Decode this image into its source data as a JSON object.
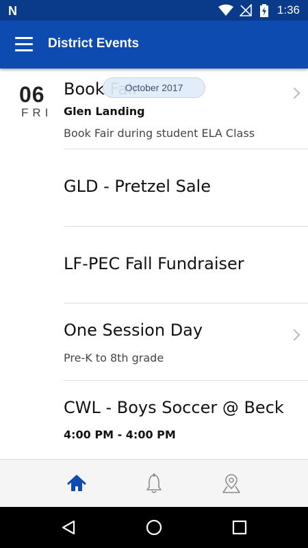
{
  "status_bar": {
    "time": "1:36"
  },
  "app_bar": {
    "title": "District Events"
  },
  "month_pill": "October 2017",
  "date_header": {
    "day_number": "06",
    "day_name": "FRI"
  },
  "events": [
    {
      "title": "Book Fair",
      "location": "Glen Landing",
      "description": "Book Fair during student ELA Class",
      "has_chevron": true
    },
    {
      "title": "GLD - Pretzel Sale"
    },
    {
      "title": "LF-PEC Fall Fundraiser"
    },
    {
      "title": "One Session Day",
      "description": "Pre-K to 8th grade",
      "has_chevron": true
    },
    {
      "title": "CWL - Boys Soccer @ Beck",
      "time": "4:00 PM - 4:00 PM"
    }
  ],
  "bottom_nav": [
    {
      "icon": "home-icon",
      "active": true
    },
    {
      "icon": "bell-icon",
      "active": false
    },
    {
      "icon": "map-pin-icon",
      "active": false
    }
  ],
  "colors": {
    "primary": "#0d4bb0",
    "status_bar": "#0a3a8a",
    "active_tab": "#0d4bb0",
    "inactive_tab": "#8a8a8a"
  }
}
